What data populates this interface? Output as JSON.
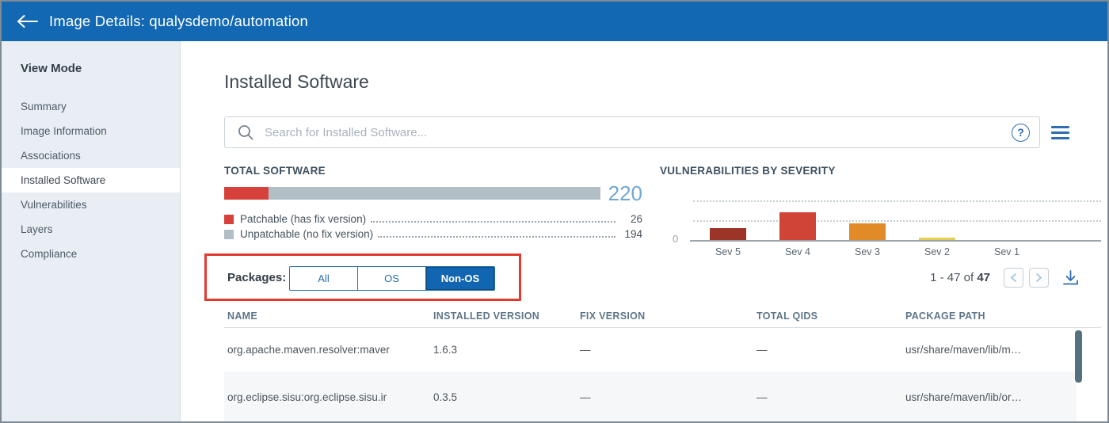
{
  "topbar": {
    "title": "Image Details: qualysdemo/automation"
  },
  "sidebar": {
    "heading": "View Mode",
    "items": [
      {
        "label": "Summary",
        "active": false
      },
      {
        "label": "Image Information",
        "active": false
      },
      {
        "label": "Associations",
        "active": false
      },
      {
        "label": "Installed Software",
        "active": true
      },
      {
        "label": "Vulnerabilities",
        "active": false
      },
      {
        "label": "Layers",
        "active": false
      },
      {
        "label": "Compliance",
        "active": false
      }
    ]
  },
  "main": {
    "title": "Installed Software",
    "search": {
      "placeholder": "Search for Installed Software..."
    },
    "total_software_heading": "TOTAL SOFTWARE",
    "vuln_heading": "VULNERABILITIES BY SEVERITY",
    "packages": {
      "label": "Packages:",
      "options": [
        {
          "label": "All",
          "selected": false
        },
        {
          "label": "OS",
          "selected": false
        },
        {
          "label": "Non-OS",
          "selected": true
        }
      ]
    },
    "pagination": {
      "range_label": "1 - 47 of",
      "total_bold": "47"
    },
    "table": {
      "columns": [
        "NAME",
        "INSTALLED VERSION",
        "FIX VERSION",
        "TOTAL QIDS",
        "PACKAGE PATH"
      ],
      "rows": [
        {
          "name": "org.apache.maven.resolver:maver",
          "installed_version": "1.6.3",
          "fix_version": "—",
          "total_qids": "—",
          "package_path": "usr/share/maven/lib/m…"
        },
        {
          "name": "org.eclipse.sisu:org.eclipse.sisu.ir",
          "installed_version": "0.3.5",
          "fix_version": "—",
          "total_qids": "—",
          "package_path": "usr/share/maven/lib/or…"
        }
      ]
    }
  },
  "chart_data": [
    {
      "type": "bar",
      "subtype": "horizontal-stacked-single-bar",
      "title": "TOTAL SOFTWARE",
      "categories": [
        "Patchable (has fix version)",
        "Unpatchable (no fix version)"
      ],
      "values": [
        26,
        194
      ],
      "total": 220,
      "colors": [
        "#d6423b",
        "#b2bec6"
      ],
      "legend_position": "below with dotted leaders to values"
    },
    {
      "type": "bar",
      "title": "VULNERABILITIES BY SEVERITY",
      "categories": [
        "Sev 5",
        "Sev 4",
        "Sev 3",
        "Sev 2",
        "Sev 1"
      ],
      "values": [
        6,
        14,
        8.5,
        1,
        0
      ],
      "colors": [
        "#9d3428",
        "#d04438",
        "#e08a28",
        "#e8cf4e",
        "#e8cf4e"
      ],
      "xlabel": "",
      "ylabel": "",
      "ylim": [
        0,
        20
      ],
      "yticks_shown": [
        "0"
      ],
      "grid": "two dotted horizontal gridlines (at 10 and 20), solid gray baseline at 0",
      "legend": "none"
    }
  ]
}
